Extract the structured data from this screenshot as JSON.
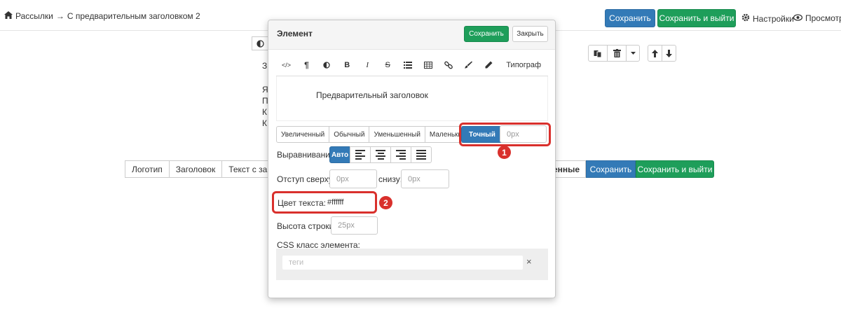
{
  "breadcrumb": {
    "home": "Рассылки",
    "arrow": "→",
    "current": "С предварительным заголовком 2"
  },
  "topbar": {
    "save": "Сохранить",
    "save_exit": "Сохранить и выйти",
    "settings": "Настройки",
    "preview": "Просмотр"
  },
  "background": {
    "letter_z": "З",
    "letters": [
      "Я",
      "П",
      "К",
      "К"
    ],
    "tabs": [
      "Логотип",
      "Заголовок",
      "Текст с заголо"
    ],
    "tab_partial_right": "енные",
    "save": "Сохранить",
    "save_exit": "Сохранить и выйти"
  },
  "modal": {
    "title": "Элемент",
    "save": "Сохранить",
    "close": "Закрыть",
    "toolbar": {
      "html": "</>",
      "paragraph": "¶",
      "bold": "B",
      "italic": "I",
      "strike": "S",
      "typograph": "Типограф"
    },
    "editor_text": "Предварительный заголовок",
    "sizes": [
      "Увеличенный",
      "Обычный",
      "Уменьшенный",
      "Маленький",
      "Точный"
    ],
    "size_value": "0px",
    "align_label": "Выравнивание",
    "align_auto": "Авто",
    "margin_top_label": "Отступ сверху:",
    "margin_top_value": "0px",
    "margin_bottom_label": "снизу:",
    "margin_bottom_value": "0px",
    "color_label": "Цвет текста:",
    "color_value": "#ffffff",
    "line_height_label": "Высота строки:",
    "line_height_value": "25px",
    "css_label": "CSS класс элемента:",
    "tags_placeholder": "теги",
    "tags_clear": "×"
  },
  "annotations": [
    "1",
    "2"
  ],
  "colors": {
    "primary": "#337ab7",
    "success": "#1e9e5a",
    "highlight": "#d9302c"
  }
}
